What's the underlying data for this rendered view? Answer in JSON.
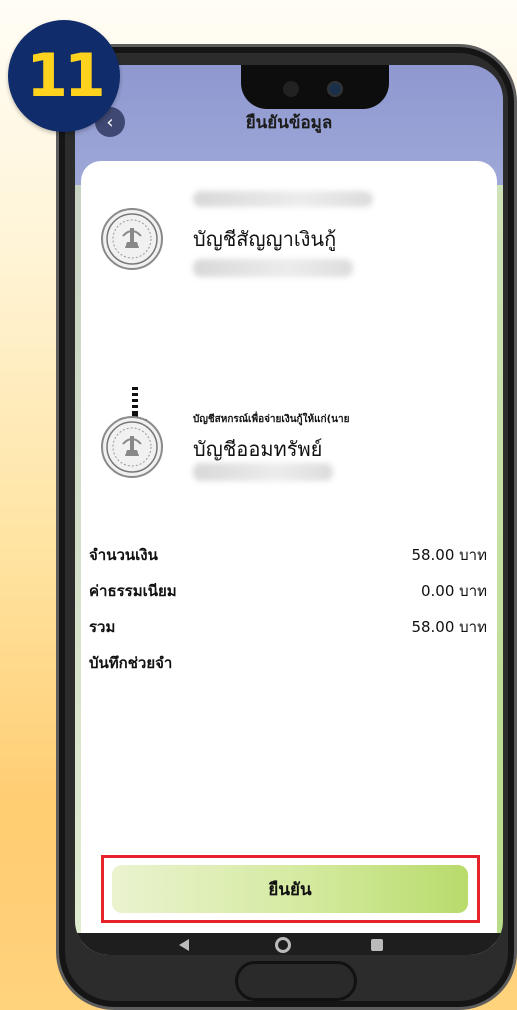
{
  "step_badge": "11",
  "header": {
    "title": "ยืนยันข้อมูล",
    "back_icon": "chevron-left-icon"
  },
  "source_account": {
    "name": "บัญชีสัญญาเงินกู้"
  },
  "destination_account": {
    "note": "บัญชีสหกรณ์เพื่อจ่ายเงินกู้ให้แก่(นาย",
    "name": "บัญชีออมทรัพย์"
  },
  "details": [
    {
      "label": "จำนวนเงิน",
      "value": "58.00 บาท"
    },
    {
      "label": "ค่าธรรมเนียม",
      "value": "0.00 บาท"
    },
    {
      "label": "รวม",
      "value": "58.00 บาท"
    },
    {
      "label": "บันทึกช่วยจำ",
      "value": ""
    }
  ],
  "confirm_button": {
    "label": "ยืนยัน"
  },
  "colors": {
    "header": "#8f98d0",
    "badge": "#102c6b",
    "badge_text": "#ffd21d",
    "highlight": "#e6232a",
    "button": "#d4ea9f"
  }
}
